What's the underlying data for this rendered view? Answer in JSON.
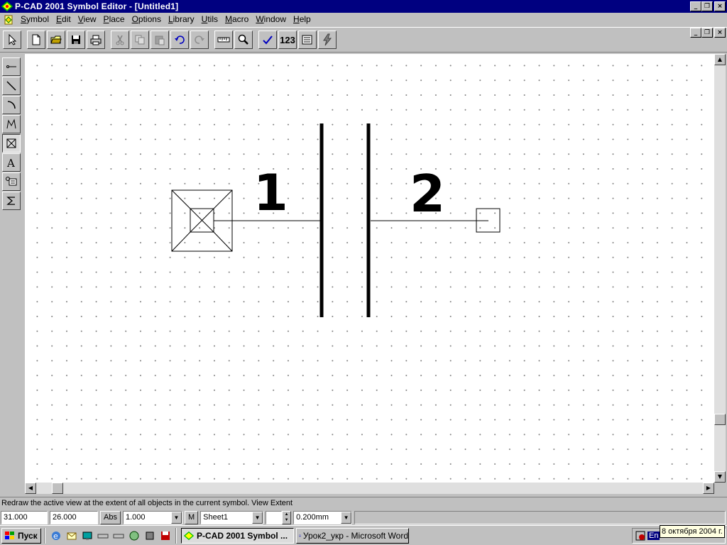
{
  "window": {
    "title": "P-CAD 2001 Symbol Editor - [Untitled1]",
    "minimize_glyph": "_",
    "restore_glyph": "❐",
    "close_glyph": "×"
  },
  "menu": [
    {
      "pre": "",
      "u": "S",
      "post": "ymbol"
    },
    {
      "pre": "",
      "u": "E",
      "post": "dit"
    },
    {
      "pre": "",
      "u": "V",
      "post": "iew"
    },
    {
      "pre": "",
      "u": "P",
      "post": "lace"
    },
    {
      "pre": "",
      "u": "O",
      "post": "ptions"
    },
    {
      "pre": "",
      "u": "L",
      "post": "ibrary"
    },
    {
      "pre": "",
      "u": "U",
      "post": "tils"
    },
    {
      "pre": "",
      "u": "M",
      "post": "acro"
    },
    {
      "pre": "",
      "u": "W",
      "post": "indow"
    },
    {
      "pre": "",
      "u": "H",
      "post": "elp"
    }
  ],
  "toolbar": {
    "pin_number_label": "123"
  },
  "symbol": {
    "pin1_number": "1",
    "pin2_number": "2"
  },
  "status": {
    "message": "Redraw the active view at the extent of all objects in the current symbol. View Extent",
    "x_coord": "31.000",
    "y_coord": "26.000",
    "abs_label": "Abs",
    "zoom_value": "1.000",
    "m_label": "M",
    "sheet_value": "Sheet1",
    "line_width_value": "0.200mm"
  },
  "taskbar": {
    "start_label": "Пуск",
    "tasks": [
      {
        "label": "P-CAD 2001 Symbol ...",
        "active": true
      },
      {
        "label": "Урок2_укр - Microsoft Word",
        "active": false
      }
    ],
    "tray_lang": "En",
    "date_tooltip": "8 октября 2004 г."
  },
  "colors": {
    "titlebar": "#000080",
    "face": "#c0c0c0",
    "canvas": "#ffffff",
    "tooltip": "#ffffe1"
  }
}
